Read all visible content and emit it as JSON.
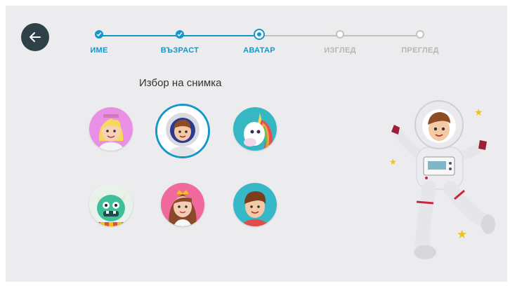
{
  "steps": [
    {
      "label": "ИМЕ",
      "state": "done"
    },
    {
      "label": "ВЪЗРАСТ",
      "state": "done"
    },
    {
      "label": "АВАТАР",
      "state": "current"
    },
    {
      "label": "ИЗГЛЕД",
      "state": "pending"
    },
    {
      "label": "ПРЕГЛЕД",
      "state": "pending"
    }
  ],
  "heading": "Избор на снимка",
  "avatars": [
    {
      "name": "blonde-girl",
      "bg": "#e98fe6"
    },
    {
      "name": "astronaut-boy",
      "bg": "#ffffff",
      "selected": true
    },
    {
      "name": "unicorn",
      "bg": "#35b8c3"
    },
    {
      "name": "green-monster",
      "bg": "#e8f2ea"
    },
    {
      "name": "princess",
      "bg": "#f0689c"
    },
    {
      "name": "boy",
      "bg": "#37b8c9"
    }
  ],
  "colors": {
    "accent": "#1497c9",
    "pending": "#c2c2c2",
    "back": "#2e4147"
  },
  "icons": {
    "back": "arrow-left-icon",
    "check": "check-icon"
  }
}
